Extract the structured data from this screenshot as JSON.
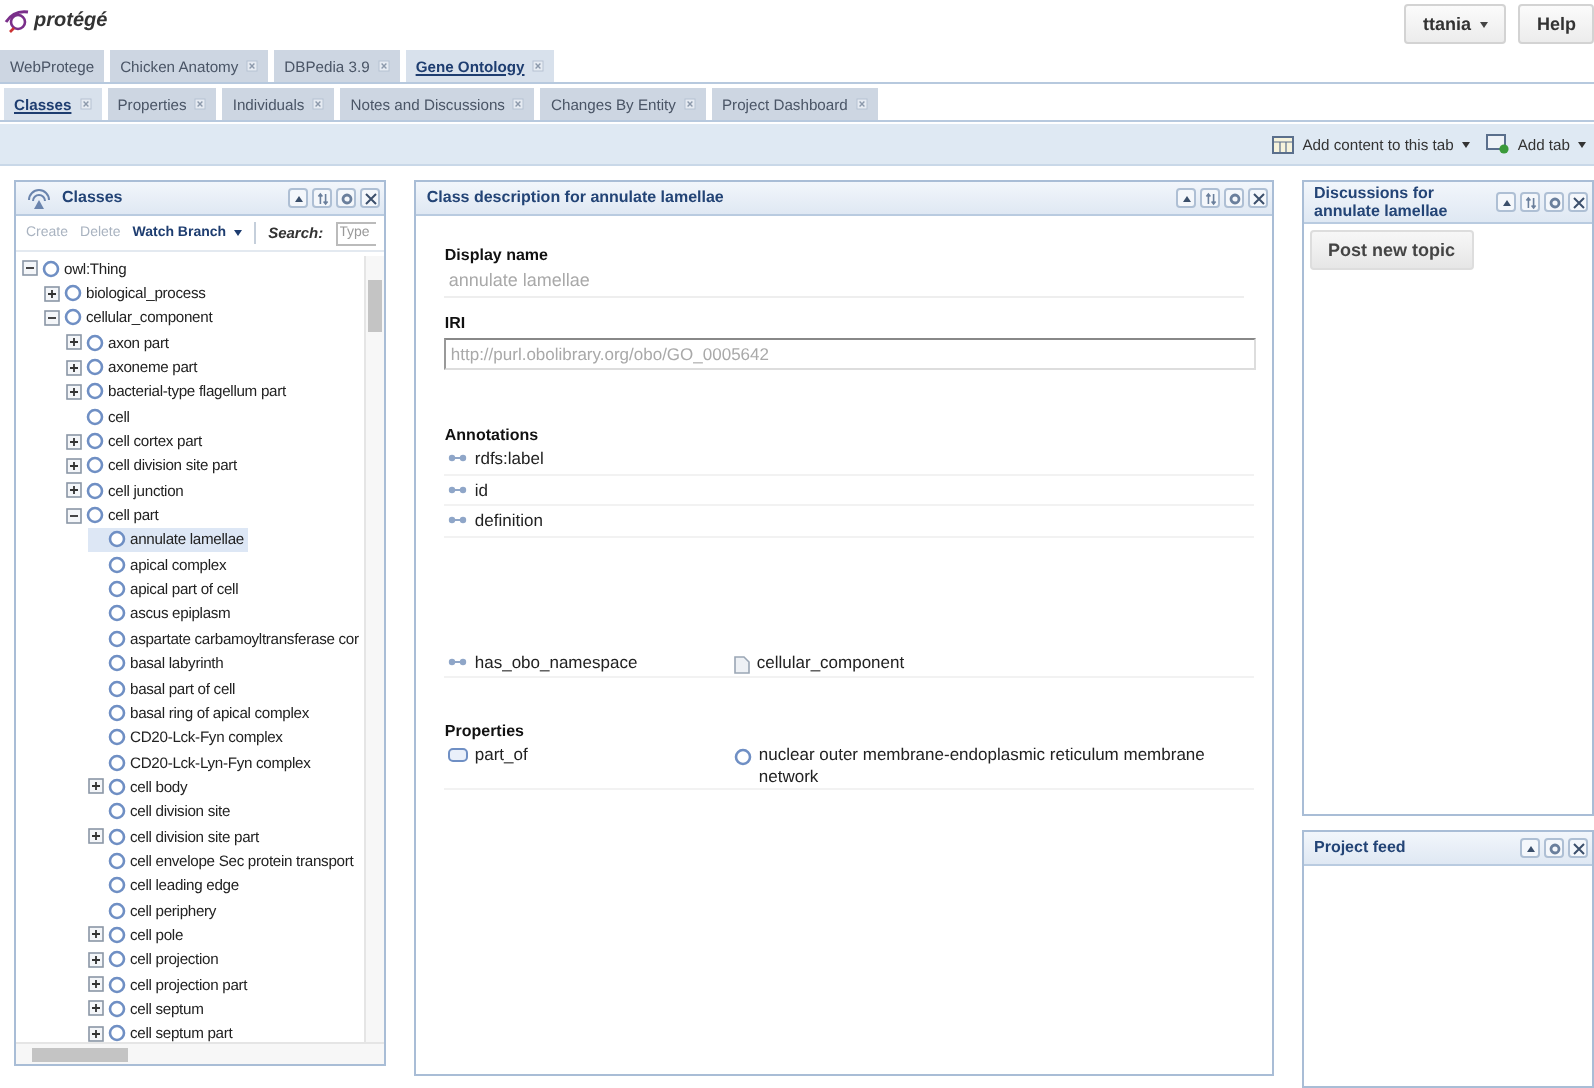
{
  "header": {
    "logo": "protégé",
    "user_menu": "ttania",
    "help_button": "Help"
  },
  "project_tabs": [
    {
      "label": "WebProtege",
      "closable": false,
      "selected": false
    },
    {
      "label": "Chicken Anatomy",
      "closable": true,
      "selected": false
    },
    {
      "label": "DBPedia 3.9",
      "closable": true,
      "selected": false
    },
    {
      "label": "Gene Ontology",
      "closable": true,
      "selected": true
    }
  ],
  "page_tabs": [
    {
      "label": "Classes",
      "selected": true
    },
    {
      "label": "Properties",
      "selected": false
    },
    {
      "label": "Individuals",
      "selected": false
    },
    {
      "label": "Notes and Discussions",
      "selected": false
    },
    {
      "label": "Changes By Entity",
      "selected": false
    },
    {
      "label": "Project Dashboard",
      "selected": false
    }
  ],
  "toolbar": {
    "add_content": "Add content to this tab",
    "add_tab": "Add tab"
  },
  "classes_panel": {
    "title": "Classes",
    "actions": [
      {
        "label": "Create",
        "disabled": true,
        "dropdown": false
      },
      {
        "label": "Delete",
        "disabled": true,
        "dropdown": false
      },
      {
        "label": "Watch Branch",
        "disabled": false,
        "dropdown": true
      }
    ],
    "search_label": "Search:",
    "search_placeholder": "Type",
    "tree": [
      {
        "label": "owl:Thing",
        "kind": "branch",
        "expanded": true,
        "selected": false,
        "children": [
          {
            "label": "biological_process",
            "kind": "branch",
            "expanded": false,
            "selected": false
          },
          {
            "label": "cellular_component",
            "kind": "branch",
            "expanded": true,
            "selected": false,
            "children": [
              {
                "label": "axon part",
                "kind": "branch",
                "expanded": false,
                "selected": false
              },
              {
                "label": "axoneme part",
                "kind": "branch",
                "expanded": false,
                "selected": false
              },
              {
                "label": "bacterial-type flagellum part",
                "kind": "branch",
                "expanded": false,
                "selected": false
              },
              {
                "label": "cell",
                "kind": "leaf",
                "selected": false
              },
              {
                "label": "cell cortex part",
                "kind": "branch",
                "expanded": false,
                "selected": false
              },
              {
                "label": "cell division site part",
                "kind": "branch",
                "expanded": false,
                "selected": false
              },
              {
                "label": "cell junction",
                "kind": "branch",
                "expanded": false,
                "selected": false
              },
              {
                "label": "cell part",
                "kind": "branch",
                "expanded": true,
                "selected": false,
                "children": [
                  {
                    "label": "annulate lamellae",
                    "kind": "leaf",
                    "selected": true
                  },
                  {
                    "label": "apical complex",
                    "kind": "leaf",
                    "selected": false
                  },
                  {
                    "label": "apical part of cell",
                    "kind": "leaf",
                    "selected": false
                  },
                  {
                    "label": "ascus epiplasm",
                    "kind": "leaf",
                    "selected": false
                  },
                  {
                    "label": "aspartate carbamoyltransferase cor",
                    "kind": "leaf",
                    "selected": false
                  },
                  {
                    "label": "basal labyrinth",
                    "kind": "leaf",
                    "selected": false
                  },
                  {
                    "label": "basal part of cell",
                    "kind": "leaf",
                    "selected": false
                  },
                  {
                    "label": "basal ring of apical complex",
                    "kind": "leaf",
                    "selected": false
                  },
                  {
                    "label": "CD20-Lck-Fyn complex",
                    "kind": "leaf",
                    "selected": false
                  },
                  {
                    "label": "CD20-Lck-Lyn-Fyn complex",
                    "kind": "leaf",
                    "selected": false
                  },
                  {
                    "label": "cell body",
                    "kind": "branch",
                    "expanded": false,
                    "selected": false
                  },
                  {
                    "label": "cell division site",
                    "kind": "leaf",
                    "selected": false
                  },
                  {
                    "label": "cell division site part",
                    "kind": "branch",
                    "expanded": false,
                    "selected": false
                  },
                  {
                    "label": "cell envelope Sec protein transport",
                    "kind": "leaf",
                    "selected": false
                  },
                  {
                    "label": "cell leading edge",
                    "kind": "leaf",
                    "selected": false
                  },
                  {
                    "label": "cell periphery",
                    "kind": "leaf",
                    "selected": false
                  },
                  {
                    "label": "cell pole",
                    "kind": "branch",
                    "expanded": false,
                    "selected": false
                  },
                  {
                    "label": "cell projection",
                    "kind": "branch",
                    "expanded": false,
                    "selected": false
                  },
                  {
                    "label": "cell projection part",
                    "kind": "branch",
                    "expanded": false,
                    "selected": false
                  },
                  {
                    "label": "cell septum",
                    "kind": "branch",
                    "expanded": false,
                    "selected": false
                  },
                  {
                    "label": "cell septum part",
                    "kind": "branch",
                    "expanded": false,
                    "selected": false
                  }
                ]
              }
            ]
          }
        ]
      }
    ]
  },
  "description_panel": {
    "title": "Class description for annulate lamellae",
    "display_name_label": "Display name",
    "display_name": "annulate lamellae",
    "iri_label": "IRI",
    "iri": "http://purl.obolibrary.org/obo/GO_0005642",
    "annotations_label": "Annotations",
    "annotations": [
      {
        "property": "rdfs:label"
      },
      {
        "property": "id"
      },
      {
        "property": "definition"
      },
      {
        "property": "has_obo_namespace",
        "value": "cellular_component"
      }
    ],
    "properties_label": "Properties",
    "properties": [
      {
        "property": "part_of",
        "value": "nuclear outer membrane-endoplasmic reticulum membrane network"
      }
    ]
  },
  "discussions_panel": {
    "title": "Discussions for annulate lamellae",
    "post_button": "Post new topic"
  },
  "feed_panel": {
    "title": "Project feed"
  }
}
